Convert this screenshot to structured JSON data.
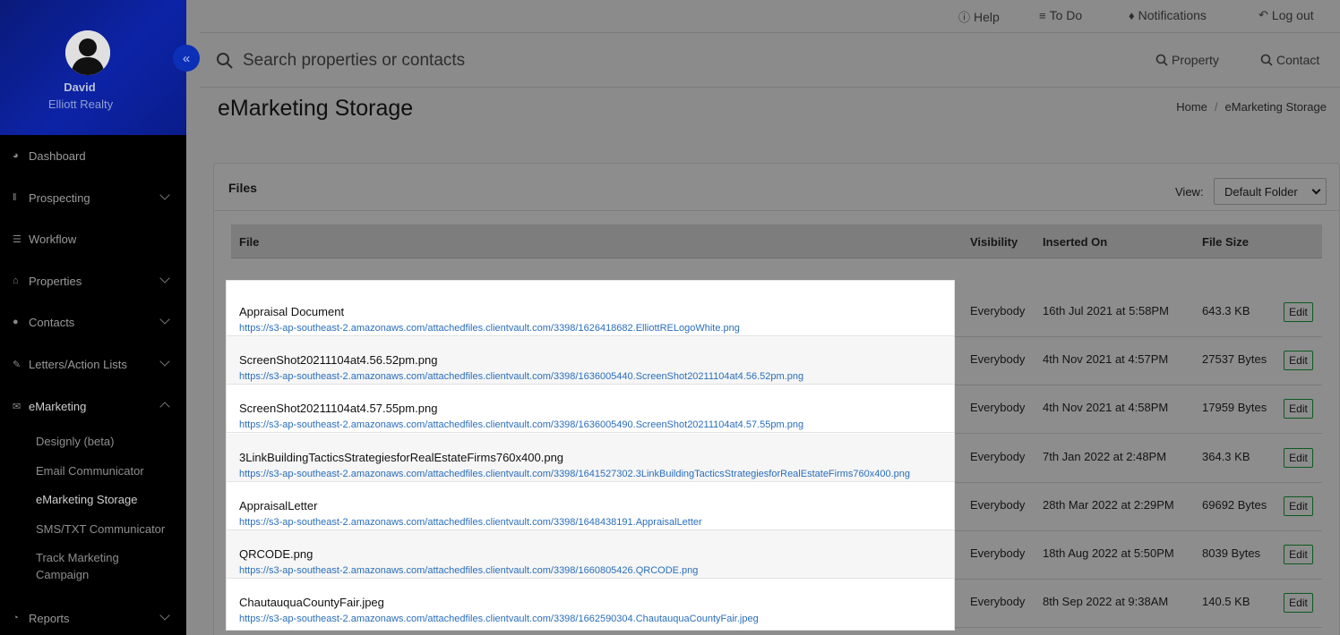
{
  "user": {
    "name": "David",
    "company": "Elliott Realty"
  },
  "sidebar": {
    "items": [
      {
        "label": "Dashboard",
        "icon": "dashboard-icon",
        "expandable": false
      },
      {
        "label": "Prospecting",
        "icon": "prospecting-icon",
        "expandable": true
      },
      {
        "label": "Workflow",
        "icon": "workflow-icon",
        "expandable": false
      },
      {
        "label": "Properties",
        "icon": "home-icon",
        "expandable": true
      },
      {
        "label": "Contacts",
        "icon": "user-icon",
        "expandable": true
      },
      {
        "label": "Letters/Action Lists",
        "icon": "edit-icon",
        "expandable": true
      },
      {
        "label": "eMarketing",
        "icon": "envelope-icon",
        "expandable": true,
        "expanded": true
      },
      {
        "label": "Reports",
        "icon": "chart-icon",
        "expandable": true
      }
    ],
    "emarketing_sub": [
      "Designly (beta)",
      "Email Communicator",
      "eMarketing Storage",
      "SMS/TXT Communicator",
      "Track Marketing Campaign"
    ]
  },
  "topbar": {
    "help": "Help",
    "todo": "To Do",
    "notifications": "Notifications",
    "logout": "Log out"
  },
  "search": {
    "placeholder": "Search properties or contacts",
    "property": "Property",
    "contact": "Contact"
  },
  "page": {
    "title": "eMarketing Storage",
    "breadcrumb": [
      "Home",
      "eMarketing Storage"
    ]
  },
  "files_card": {
    "title": "Files",
    "view_label": "View:",
    "view_value": "Default Folder",
    "columns": [
      "File",
      "Visibility",
      "Inserted On",
      "File Size"
    ],
    "edit_label": "Edit",
    "rows": [
      {
        "name": "Appraisal Document",
        "url": "https://s3-ap-southeast-2.amazonaws.com/attachedfiles.clientvault.com/3398/1626418682.ElliottRELogoWhite.png",
        "visibility": "Everybody",
        "inserted": "16th Jul 2021 at 5:58PM",
        "size": "643.3 KB"
      },
      {
        "name": "ScreenShot20211104at4.56.52pm.png",
        "url": "https://s3-ap-southeast-2.amazonaws.com/attachedfiles.clientvault.com/3398/1636005440.ScreenShot20211104at4.56.52pm.png",
        "visibility": "Everybody",
        "inserted": "4th Nov 2021 at 4:57PM",
        "size": "27537 Bytes"
      },
      {
        "name": "ScreenShot20211104at4.57.55pm.png",
        "url": "https://s3-ap-southeast-2.amazonaws.com/attachedfiles.clientvault.com/3398/1636005490.ScreenShot20211104at4.57.55pm.png",
        "visibility": "Everybody",
        "inserted": "4th Nov 2021 at 4:58PM",
        "size": "17959 Bytes"
      },
      {
        "name": "3LinkBuildingTacticsStrategiesforRealEstateFirms760x400.png",
        "url": "https://s3-ap-southeast-2.amazonaws.com/attachedfiles.clientvault.com/3398/1641527302.3LinkBuildingTacticsStrategiesforRealEstateFirms760x400.png",
        "visibility": "Everybody",
        "inserted": "7th Jan 2022 at 2:48PM",
        "size": "364.3 KB"
      },
      {
        "name": "AppraisalLetter",
        "url": "https://s3-ap-southeast-2.amazonaws.com/attachedfiles.clientvault.com/3398/1648438191.AppraisalLetter",
        "visibility": "Everybody",
        "inserted": "28th Mar 2022 at 2:29PM",
        "size": "69692 Bytes"
      },
      {
        "name": "QRCODE.png",
        "url": "https://s3-ap-southeast-2.amazonaws.com/attachedfiles.clientvault.com/3398/1660805426.QRCODE.png",
        "visibility": "Everybody",
        "inserted": "18th Aug 2022 at 5:50PM",
        "size": "8039 Bytes"
      },
      {
        "name": "ChautauquaCountyFair.jpeg",
        "url": "https://s3-ap-southeast-2.amazonaws.com/attachedfiles.clientvault.com/3398/1662590304.ChautauquaCountyFair.jpeg",
        "visibility": "Everybody",
        "inserted": "8th Sep 2022 at 9:38AM",
        "size": "140.5 KB"
      }
    ]
  },
  "colors": {
    "sidebar_bg": "#000000",
    "profile_bg": "#0c23a6",
    "link": "#2a6ebb",
    "edit_border": "#0c5a20"
  }
}
